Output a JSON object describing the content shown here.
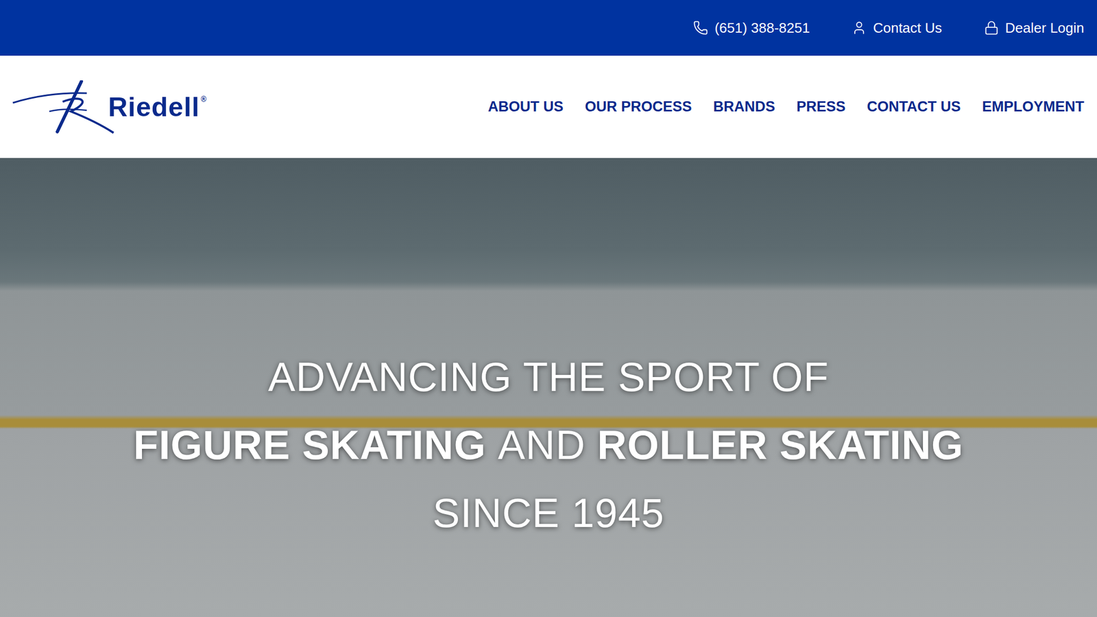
{
  "top_bar": {
    "items": [
      {
        "label": "(651) 388-8251",
        "kind": "phone"
      },
      {
        "label": "Contact Us",
        "kind": "contact"
      },
      {
        "label": "Dealer Login",
        "kind": "login"
      }
    ]
  },
  "logo": {
    "text": "Riedell",
    "mark": "®"
  },
  "nav": {
    "items": [
      {
        "label": "ABOUT US"
      },
      {
        "label": "OUR PROCESS"
      },
      {
        "label": "BRANDS"
      },
      {
        "label": "PRESS"
      },
      {
        "label": "CONTACT US"
      },
      {
        "label": "EMPLOYMENT"
      }
    ]
  },
  "hero": {
    "lines": [
      [
        {
          "text": "ADVANCING THE SPORT OF",
          "bold": false
        }
      ],
      [
        {
          "text": "FIGURE SKATING",
          "bold": true
        },
        {
          "text": "AND",
          "bold": false
        },
        {
          "text": "ROLLER SKATING",
          "bold": true
        }
      ],
      [
        {
          "text": "SINCE 1945",
          "bold": false
        }
      ]
    ]
  }
}
